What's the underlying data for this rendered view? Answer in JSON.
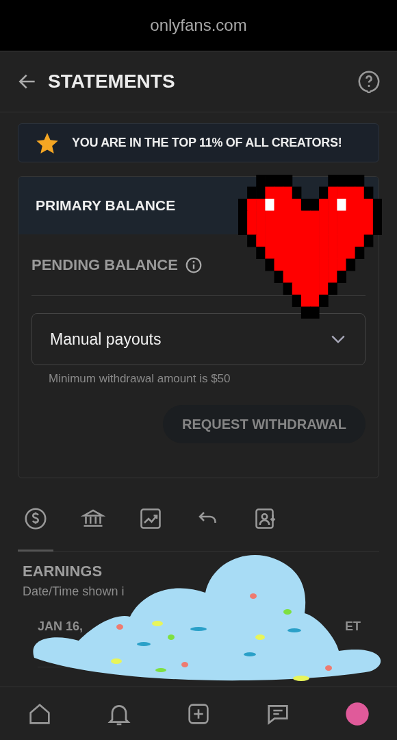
{
  "browser_bar": {
    "domain": "onlyfans.com"
  },
  "header": {
    "title": "STATEMENTS"
  },
  "banner": {
    "text": "YOU ARE IN THE TOP 11% OF ALL CREATORS!"
  },
  "balance_card": {
    "primary_label": "PRIMARY BALANCE",
    "pending_label": "PENDING BALANCE",
    "payout_select": {
      "value": "Manual payouts"
    },
    "hint": "Minimum withdrawal amount is $50",
    "button": {
      "label": "REQUEST WITHDRAWAL",
      "disabled": true
    }
  },
  "tabs": [
    {
      "selected": true
    },
    {
      "selected": false
    },
    {
      "selected": false
    },
    {
      "selected": false
    },
    {
      "selected": false
    }
  ],
  "earnings": {
    "title": "EARNINGS",
    "note": "Date/Time shown i",
    "row": {
      "date": "JAN 16,",
      "column_2": "ET"
    }
  }
}
